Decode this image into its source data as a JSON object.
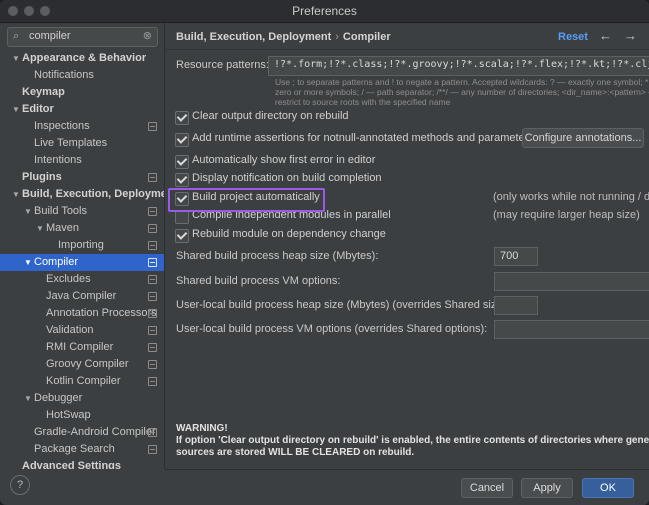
{
  "window": {
    "title": "Preferences"
  },
  "search": {
    "value": "compiler",
    "icon": "search-icon"
  },
  "tree": [
    {
      "label": "Appearance & Behavior",
      "bold": true,
      "arrow": "down",
      "indent": 0,
      "marker": false
    },
    {
      "label": "Notifications",
      "bold": false,
      "arrow": "",
      "indent": 1,
      "marker": false
    },
    {
      "label": "Keymap",
      "bold": true,
      "arrow": "",
      "indent": 0,
      "marker": false
    },
    {
      "label": "Editor",
      "bold": true,
      "arrow": "down",
      "indent": 0,
      "marker": false
    },
    {
      "label": "Inspections",
      "bold": false,
      "arrow": "",
      "indent": 1,
      "marker": true
    },
    {
      "label": "Live Templates",
      "bold": false,
      "arrow": "",
      "indent": 1,
      "marker": false
    },
    {
      "label": "Intentions",
      "bold": false,
      "arrow": "",
      "indent": 1,
      "marker": false
    },
    {
      "label": "Plugins",
      "bold": true,
      "arrow": "",
      "indent": 0,
      "marker": true
    },
    {
      "label": "Build, Execution, Deploymen",
      "bold": true,
      "arrow": "down",
      "indent": 0,
      "marker": false
    },
    {
      "label": "Build Tools",
      "bold": false,
      "arrow": "down",
      "indent": 1,
      "marker": true
    },
    {
      "label": "Maven",
      "bold": false,
      "arrow": "down",
      "indent": 2,
      "marker": true
    },
    {
      "label": "Importing",
      "bold": false,
      "arrow": "",
      "indent": 3,
      "marker": true
    },
    {
      "label": "Compiler",
      "bold": false,
      "arrow": "down",
      "indent": 1,
      "marker": true,
      "selected": true
    },
    {
      "label": "Excludes",
      "bold": false,
      "arrow": "",
      "indent": 2,
      "marker": true
    },
    {
      "label": "Java Compiler",
      "bold": false,
      "arrow": "",
      "indent": 2,
      "marker": true
    },
    {
      "label": "Annotation Processors",
      "bold": false,
      "arrow": "",
      "indent": 2,
      "marker": true
    },
    {
      "label": "Validation",
      "bold": false,
      "arrow": "",
      "indent": 2,
      "marker": true
    },
    {
      "label": "RMI Compiler",
      "bold": false,
      "arrow": "",
      "indent": 2,
      "marker": true
    },
    {
      "label": "Groovy Compiler",
      "bold": false,
      "arrow": "",
      "indent": 2,
      "marker": true
    },
    {
      "label": "Kotlin Compiler",
      "bold": false,
      "arrow": "",
      "indent": 2,
      "marker": true
    },
    {
      "label": "Debugger",
      "bold": false,
      "arrow": "down",
      "indent": 1,
      "marker": false
    },
    {
      "label": "HotSwap",
      "bold": false,
      "arrow": "",
      "indent": 2,
      "marker": false
    },
    {
      "label": "Gradle-Android Compiler",
      "bold": false,
      "arrow": "",
      "indent": 1,
      "marker": true
    },
    {
      "label": "Package Search",
      "bold": false,
      "arrow": "",
      "indent": 1,
      "marker": true
    },
    {
      "label": "Advanced Settings",
      "bold": true,
      "arrow": "",
      "indent": 0,
      "marker": false
    }
  ],
  "header": {
    "crumb1": "Build, Execution, Deployment",
    "sep": "›",
    "crumb2": "Compiler",
    "reset": "Reset",
    "back": "←",
    "forward": "→"
  },
  "resource": {
    "label": "Resource patterns:",
    "value": "!?*.form;!?*.class;!?*.groovy;!?*.scala;!?*.flex;!?*.kt;!?*.clj;!?*.aj",
    "hint1": "Use ; to separate patterns and ! to negate a pattern. Accepted wildcards: ? — exactly one symbol; * — zero or more symbols",
    "hint2": "zero or more symbols; / — path separator; /**/ — any number of directories; <dir_name>:<pattern> — restrict to source roots with",
    "hint3": "restrict to source roots with the specified name"
  },
  "options": [
    {
      "label": "Clear output directory on rebuild",
      "checked": true,
      "note": "",
      "button": ""
    },
    {
      "label": "Add runtime assertions for notnull-annotated methods and parameters",
      "checked": true,
      "note": "",
      "button": "Configure annotations..."
    },
    {
      "label": "Automatically show first error in editor",
      "checked": true,
      "note": "",
      "button": ""
    },
    {
      "label": "Display notification on build completion",
      "checked": true,
      "note": "",
      "button": ""
    },
    {
      "label": "Build project automatically",
      "checked": true,
      "note": "(only works while not running / debugging)",
      "button": "",
      "highlight": true
    },
    {
      "label": "Compile independent modules in parallel",
      "checked": false,
      "note": "(may require larger heap size)",
      "button": ""
    },
    {
      "label": "Rebuild module on dependency change",
      "checked": true,
      "note": "",
      "button": ""
    }
  ],
  "fields": [
    {
      "label": "Shared build process heap size (Mbytes):",
      "value": "700"
    },
    {
      "label": "Shared build process VM options:",
      "value": ""
    },
    {
      "label": "User-local build process heap size (Mbytes) (overrides Shared size):",
      "value": ""
    },
    {
      "label": "User-local build process VM options (overrides Shared options):",
      "value": ""
    }
  ],
  "warning": {
    "title": "WARNING!",
    "line1": "If option 'Clear output directory on rebuild' is enabled, the entire contents of directories where generated",
    "line2": "sources are stored WILL BE CLEARED on rebuild."
  },
  "footer": {
    "help": "?",
    "cancel": "Cancel",
    "apply": "Apply",
    "ok": "OK"
  },
  "colors": {
    "accent": "#2f65ca",
    "link": "#589df6",
    "highlight": "#9b5ae6",
    "ok": "#365f9c"
  }
}
